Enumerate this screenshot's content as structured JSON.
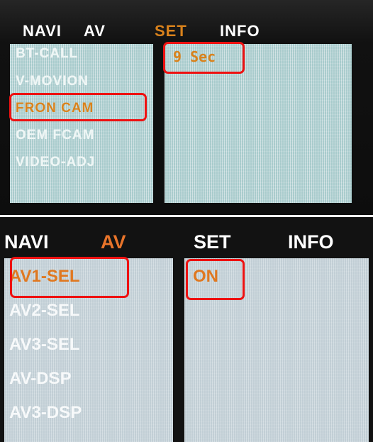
{
  "colors": {
    "screen_background": "#111111",
    "menu_background": "#c9d6dc",
    "selected_orange": "#e07820",
    "highlight_red": "#ee1111",
    "normal_text": "#ffffff"
  },
  "top_screen": {
    "tabs": [
      {
        "label": "NAVI",
        "active": false
      },
      {
        "label": "AV",
        "active": false
      },
      {
        "label": "SET",
        "active": true
      },
      {
        "label": "INFO",
        "active": false
      }
    ],
    "menu_items": [
      {
        "label": "BT-CALL",
        "selected": false
      },
      {
        "label": "V-MOVION",
        "selected": false
      },
      {
        "label": "FRON CAM",
        "selected": true
      },
      {
        "label": "OEM FCAM",
        "selected": false
      },
      {
        "label": "VIDEO-ADJ",
        "selected": false
      }
    ],
    "value": "9 Sec"
  },
  "bottom_screen": {
    "tabs": [
      {
        "label": "NAVI",
        "active": false
      },
      {
        "label": "AV",
        "active": true
      },
      {
        "label": "SET",
        "active": false
      },
      {
        "label": "INFO",
        "active": false
      }
    ],
    "menu_items": [
      {
        "label": "AV1-SEL",
        "selected": true
      },
      {
        "label": "AV2-SEL",
        "selected": false
      },
      {
        "label": "AV3-SEL",
        "selected": false
      },
      {
        "label": "AV-DSP",
        "selected": false
      },
      {
        "label": "AV3-DSP",
        "selected": false
      }
    ],
    "value": "ON"
  }
}
